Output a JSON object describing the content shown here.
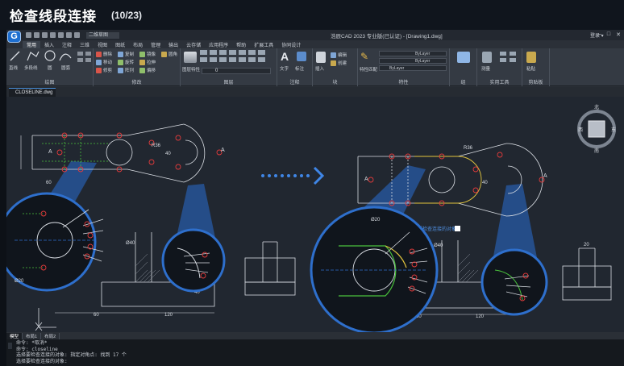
{
  "slide": {
    "title": "检查线段连接",
    "counter": "(10/23)"
  },
  "app": {
    "logo": "G",
    "workspace": "二维草图",
    "doc_title": "浩辰CAD 2023 专业版(已认证) - [Drawing1.dwg]",
    "help": "登录 ▾",
    "window_controls": [
      "—",
      "□",
      "✕"
    ]
  },
  "menu": [
    "常用",
    "插入",
    "注释",
    "三维",
    "视图",
    "图纸",
    "布局",
    "管理",
    "输出",
    "云存储",
    "应用程序",
    "帮助",
    "扩展工具",
    "协同设计"
  ],
  "ribbon": {
    "draw": {
      "label": "绘图",
      "buttons": [
        "直线",
        "多段线",
        "圆",
        "圆弧"
      ]
    },
    "modify": {
      "label": "修改",
      "buttons": [
        "删除",
        "复制",
        "镜像",
        "圆角",
        "移动",
        "旋转",
        "拉伸",
        "修剪",
        "阵列",
        "偏移"
      ]
    },
    "layers": {
      "label": "图层",
      "layer_combo": "0",
      "buttons": [
        "图层特性"
      ]
    },
    "annotation": {
      "label": "注释",
      "buttons": [
        "文字",
        "标注"
      ]
    },
    "block": {
      "label": "块",
      "buttons": [
        "插入",
        "编辑",
        "创建"
      ]
    },
    "properties": {
      "label": "特性",
      "bylayer_1": "ByLayer",
      "bylayer_2": "ByLayer",
      "bylayer_3": "ByLayer",
      "buttons": [
        "特性匹配"
      ]
    },
    "groups": {
      "label": "组"
    },
    "utilities": {
      "label": "实用工具",
      "buttons": [
        "测量"
      ]
    },
    "clipboard": {
      "label": "剪贴板",
      "buttons": [
        "粘贴"
      ]
    }
  },
  "tab": {
    "file": "CLOSELINE.dwg"
  },
  "canvas": {
    "left": {
      "dims": [
        "60",
        "120",
        "40",
        "Ø40",
        "R36",
        "40",
        "Ø20",
        "60",
        "A",
        "A"
      ],
      "view_label": ""
    },
    "right": {
      "tooltip": "选择要检查连接的对象:",
      "dims": [
        "60",
        "120",
        "40",
        "Ø40",
        "R36",
        "40",
        "Ø20",
        "A",
        "A",
        "20"
      ]
    },
    "viewcube": {
      "top": "上",
      "left": "西",
      "right": "东",
      "bottom": "南",
      "north": "北"
    },
    "arrow": "→"
  },
  "layouts": [
    "模型",
    "布局1",
    "布局2"
  ],
  "command_lines": [
    "命令: *取消*",
    "命令: closeline",
    "选择要检查连接的对象: 指定对角点: 找到 17 个",
    "选择要检查连接的对象:"
  ],
  "colors": {
    "accent": "#1e6fd0",
    "marker": "#e23b3b",
    "highlight_green": "#49c23c",
    "highlight_yellow": "#e2c53d",
    "canvas": "#212730"
  }
}
